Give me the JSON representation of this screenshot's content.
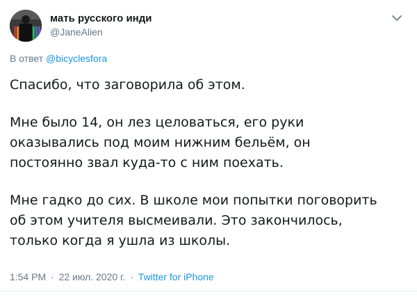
{
  "author": {
    "display_name": "мать русского инди",
    "handle": "@JaneAlien"
  },
  "reply": {
    "prefix": "В ответ",
    "to": "@bicyclesfora"
  },
  "tweet": {
    "paragraphs": [
      "Спасибо, что заговорила об этом.",
      "Мне было 14, он лез целоваться, его руки\nоказывались под моим нижним бельём, он\nпостоянно звал куда-то с ним поехать.",
      "Мне гадко до сих. В школе мои попытки поговорить\nоб этом учителя высмеивали. Это закончилось,\nтолько когда я ушла из школы."
    ]
  },
  "meta": {
    "time": "1:54 PM",
    "separator1": "·",
    "date": "22 июл. 2020 г.",
    "separator2": "·",
    "source": "Twitter for iPhone"
  },
  "icons": {
    "menu": "chevron-down-icon"
  },
  "colors": {
    "text": "#14171a",
    "secondary": "#657786",
    "link": "#1b95e0"
  }
}
